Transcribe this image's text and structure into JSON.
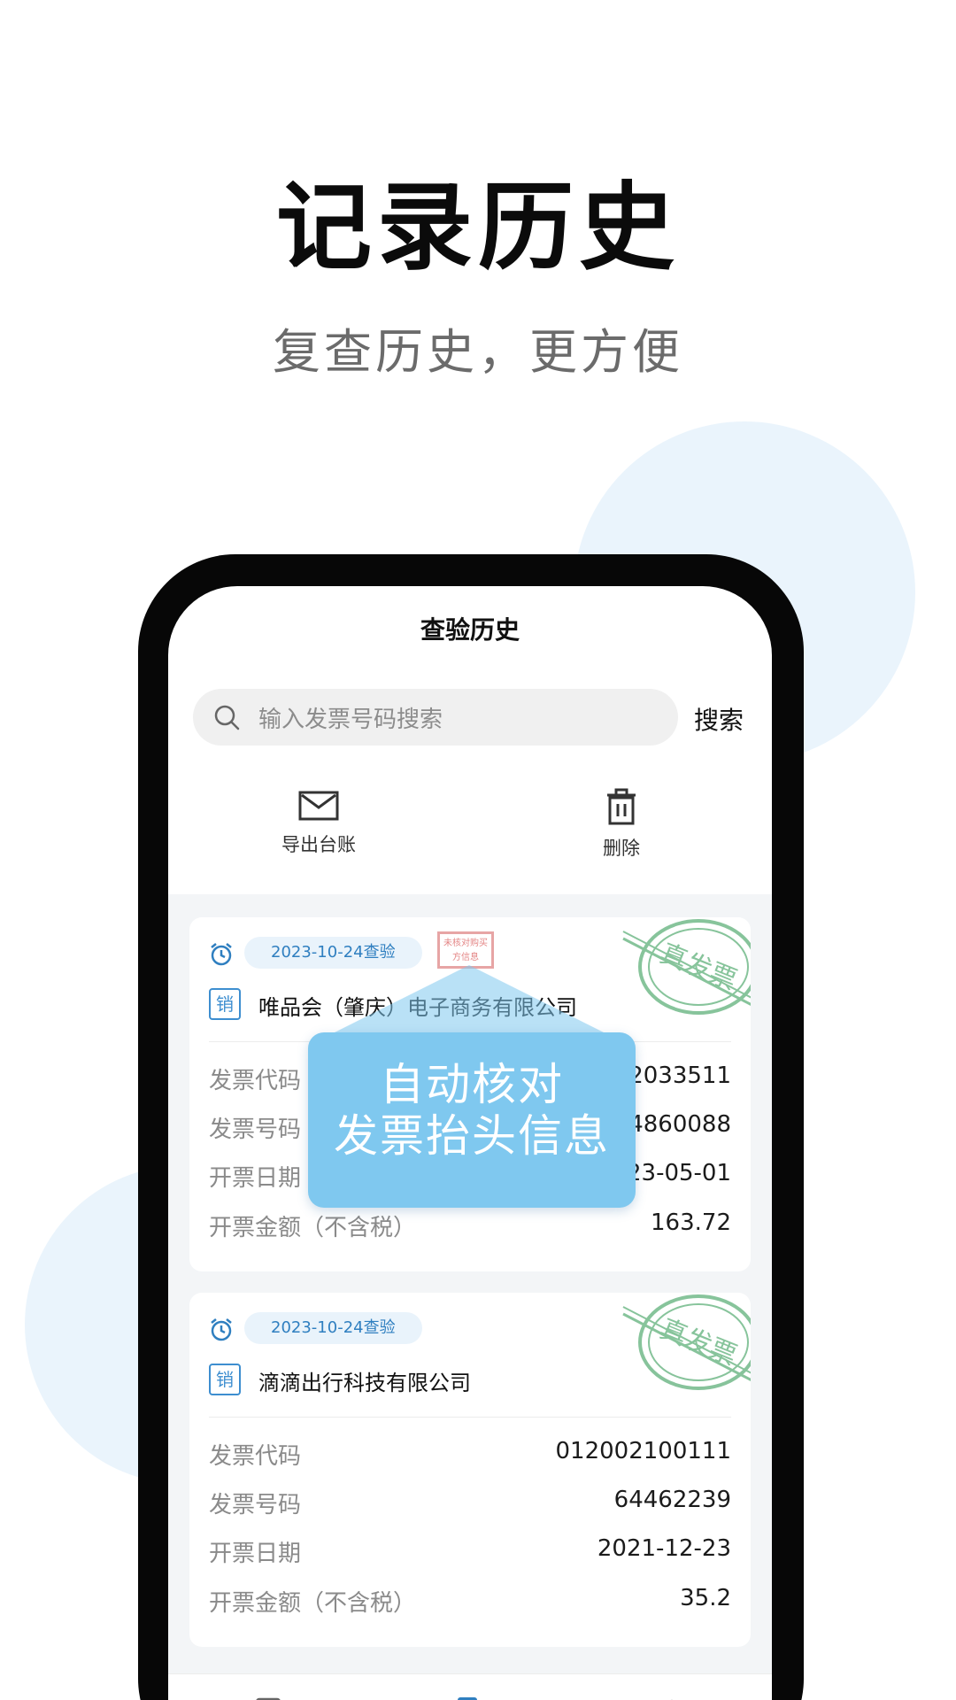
{
  "promo": {
    "title": "记录历史",
    "subtitle": "复查历史，更方便"
  },
  "app": {
    "title": "查验历史",
    "search": {
      "placeholder": "输入发票号码搜索",
      "button_label": "搜索"
    },
    "actions": {
      "export_label": "导出台账",
      "delete_label": "删除"
    }
  },
  "records": [
    {
      "check_date": "2023-10-24查验",
      "seller_tag": "销",
      "seller_name": "唯品会（肇庆）电子商务有限公司",
      "stamp_text": "真发票",
      "header_check_stamp": "未核对购买方信息",
      "rows": [
        {
          "label": "发票代码",
          "value": "2033511"
        },
        {
          "label": "发票号码",
          "value": "4860088"
        },
        {
          "label": "开票日期",
          "value": "23-05-01"
        },
        {
          "label": "开票金额（不含税）",
          "value": "163.72"
        }
      ]
    },
    {
      "check_date": "2023-10-24查验",
      "seller_tag": "销",
      "seller_name": "滴滴出行科技有限公司",
      "stamp_text": "真发票",
      "rows": [
        {
          "label": "发票代码",
          "value": "012002100111"
        },
        {
          "label": "发票号码",
          "value": "64462239"
        },
        {
          "label": "开票日期",
          "value": "2021-12-23"
        },
        {
          "label": "开票金额（不含税）",
          "value": "35.2"
        }
      ]
    }
  ],
  "callout": {
    "line1": "自动核对",
    "line2": "发票抬头信息"
  },
  "tabbar": {
    "icons": [
      "image-scan-icon",
      "history-doc-icon",
      "crown-icon"
    ]
  },
  "colors": {
    "accent_blue": "#2f7fc0",
    "callout_blue": "#7fc8ef",
    "stamp_green": "#5fb07a",
    "background_circle": "#eaf4fc"
  }
}
